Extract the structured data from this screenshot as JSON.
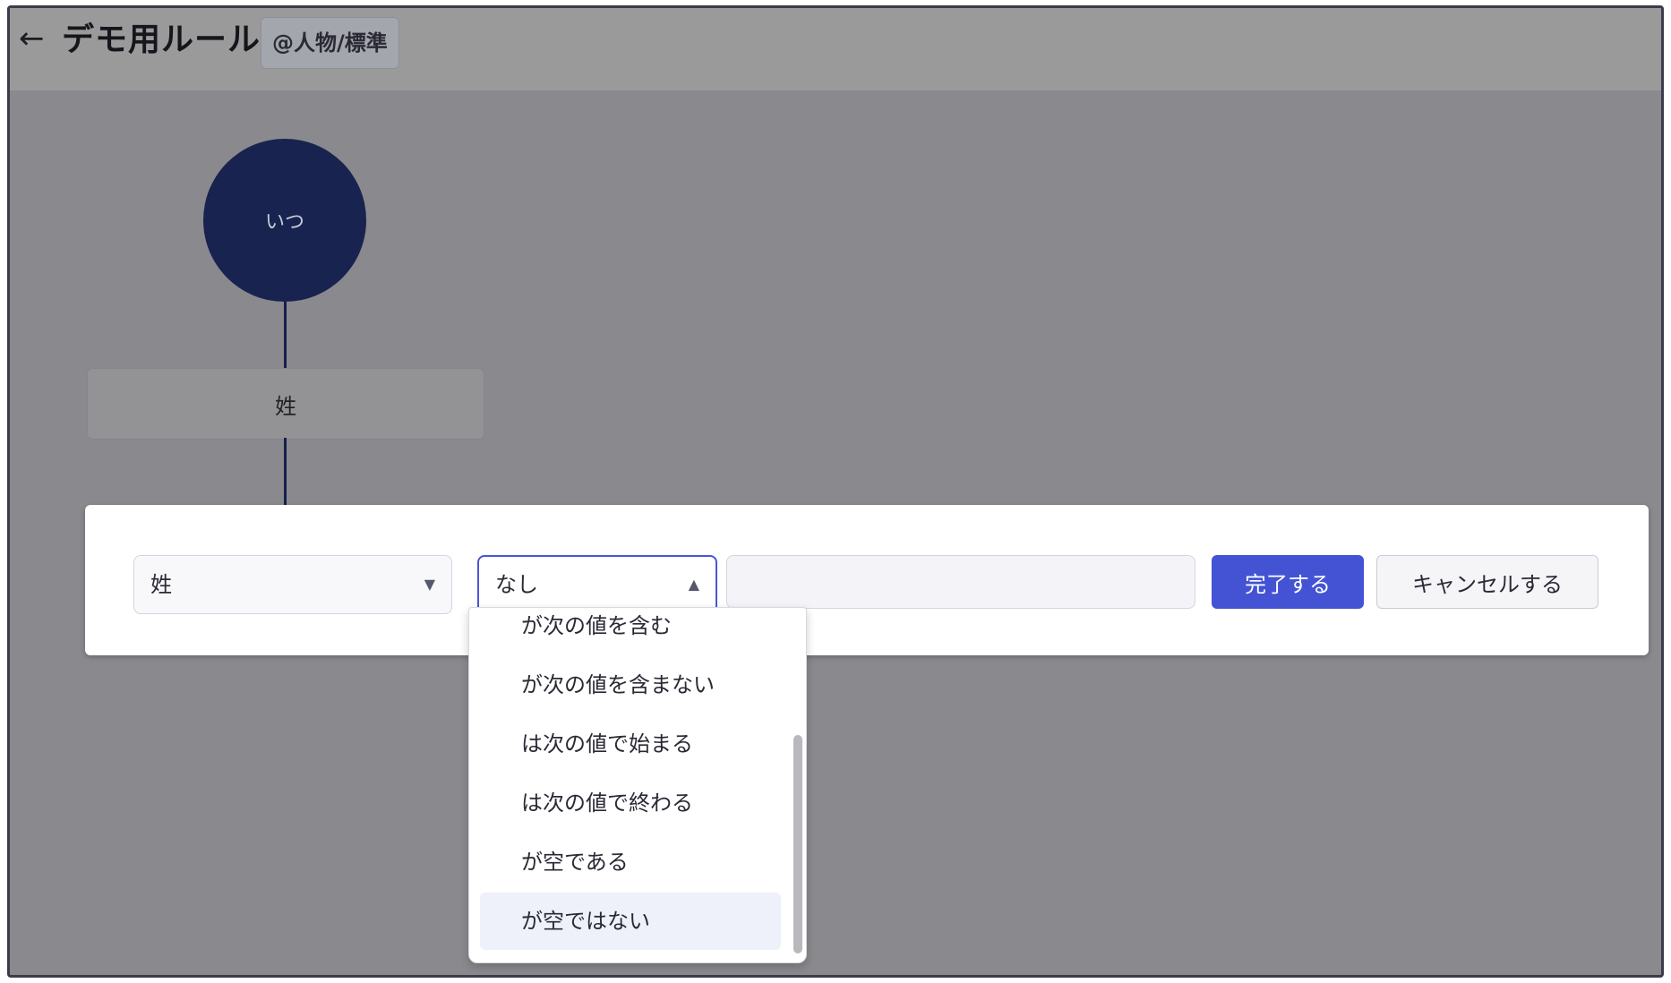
{
  "header": {
    "back_icon": "arrow-left-icon",
    "back_glyph": "←",
    "title": "デモ用ルール",
    "scope_badge": "@人物/標準"
  },
  "flow": {
    "when_node_label": "いつ",
    "field_node_label": "姓"
  },
  "condition_editor": {
    "field_select_value": "姓",
    "operator_select_value": "なし",
    "value_input": "",
    "done_label": "完了する",
    "cancel_label": "キャンセルする"
  },
  "operator_options": [
    "が次の値を含む",
    "が次の値を含まない",
    "は次の値で始まる",
    "は次の値で終わる",
    "が空である",
    "が空ではない"
  ],
  "highlighted_option": "が空ではない",
  "colors": {
    "node_navy": "#18234f",
    "primary_button": "#4353d4",
    "focus_border": "#4656d8"
  }
}
